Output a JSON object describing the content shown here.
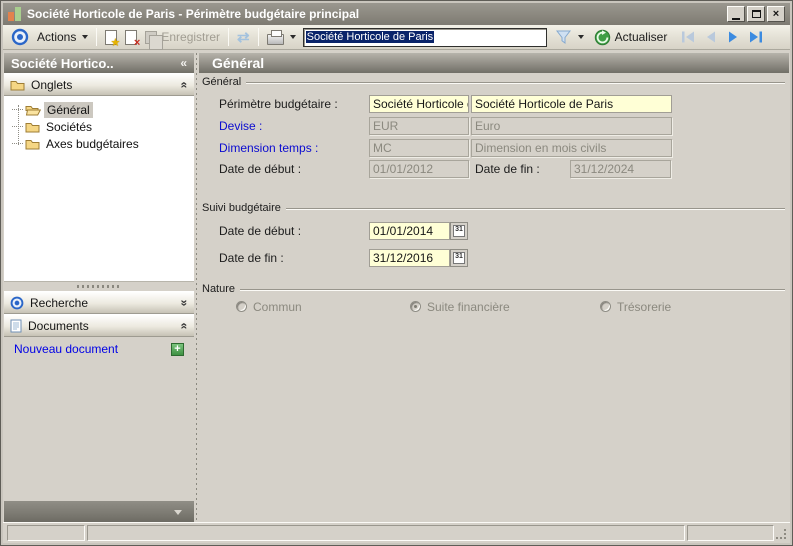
{
  "window": {
    "title": "Société Horticole de Paris -  Périmètre budgétaire principal",
    "close_glyph": "×"
  },
  "toolbar": {
    "actions_label": "Actions",
    "save_label": "Enregistrer",
    "combo_value": "Société Horticole de Paris",
    "actualiser_label": "Actualiser"
  },
  "sidebar": {
    "header_title": "Société Hortico..",
    "header_chevron": "«",
    "panels": {
      "onglets": {
        "label": "Onglets",
        "collapse_glyph": "«",
        "items": [
          {
            "label": "Général",
            "selected": true
          },
          {
            "label": "Sociétés",
            "selected": false
          },
          {
            "label": "Axes budgétaires",
            "selected": false
          }
        ]
      },
      "recherche": {
        "label": "Recherche",
        "collapse_glyph": "»"
      },
      "documents": {
        "label": "Documents",
        "collapse_glyph": "«"
      }
    },
    "documents_link": {
      "label": "Nouveau document",
      "add_glyph": "+"
    }
  },
  "main": {
    "header": "Général",
    "groups": {
      "general": {
        "title": "Général",
        "fields": [
          {
            "label": "Périmètre budgétaire :",
            "code": "Société Horticole de",
            "name": "Société Horticole de Paris",
            "editable": true
          },
          {
            "label": "Devise :",
            "code": "EUR",
            "name": "Euro",
            "editable": false
          },
          {
            "label": "Dimension temps :",
            "code": "MC",
            "name": "Dimension en mois civils",
            "editable": false
          }
        ],
        "date_row": {
          "start_label": "Date de début :",
          "start_value": "01/01/2012",
          "end_label": "Date de fin :",
          "end_value": "31/12/2024"
        }
      },
      "suivi": {
        "title": "Suivi budgétaire",
        "rows": [
          {
            "label": "Date de début :",
            "value": "01/01/2014"
          },
          {
            "label": "Date de fin :",
            "value": "31/12/2016"
          }
        ],
        "calendar_glyph": "31"
      },
      "nature": {
        "title": "Nature",
        "options": [
          {
            "label": "Commun",
            "selected": false
          },
          {
            "label": "Suite financière",
            "selected": true
          },
          {
            "label": "Trésorerie",
            "selected": false
          }
        ]
      }
    }
  },
  "icons": {
    "app_icon": "bar-chart",
    "target_icon": "blue-bullseye",
    "new_document_icon": "page-with-star",
    "delete_icon": "page-with-red-x",
    "save_icon": "gray-sheets",
    "sync_icon": "blue-double-arrows",
    "print_icon": "printer-with-dropdown",
    "filter_icon": "blue-funnel",
    "refresh_icon": "green-circle-arrow",
    "nav_icons": "first-previous-next-last",
    "folder_icon": "yellow-folder",
    "document_icon": "white-page-blue-lines",
    "calendar_icon": "calendar-31",
    "add_icon": "green-plus"
  },
  "colors": {
    "window_bg": "#d5d1c9",
    "titlebar": "#8b887f",
    "header_gradient_top": "#b6b3ab",
    "header_gradient_bottom": "#716f67",
    "selection_blue": "#0a246a",
    "editable_field_yellow": "#ffffd6",
    "link_blue": "#0b0bd0",
    "hyperlink_blue": "#0000e6",
    "accent_green": "#3e9142",
    "nav_enabled_blue": "#3c8be0",
    "nav_disabled_blue": "#b9c9dc"
  }
}
